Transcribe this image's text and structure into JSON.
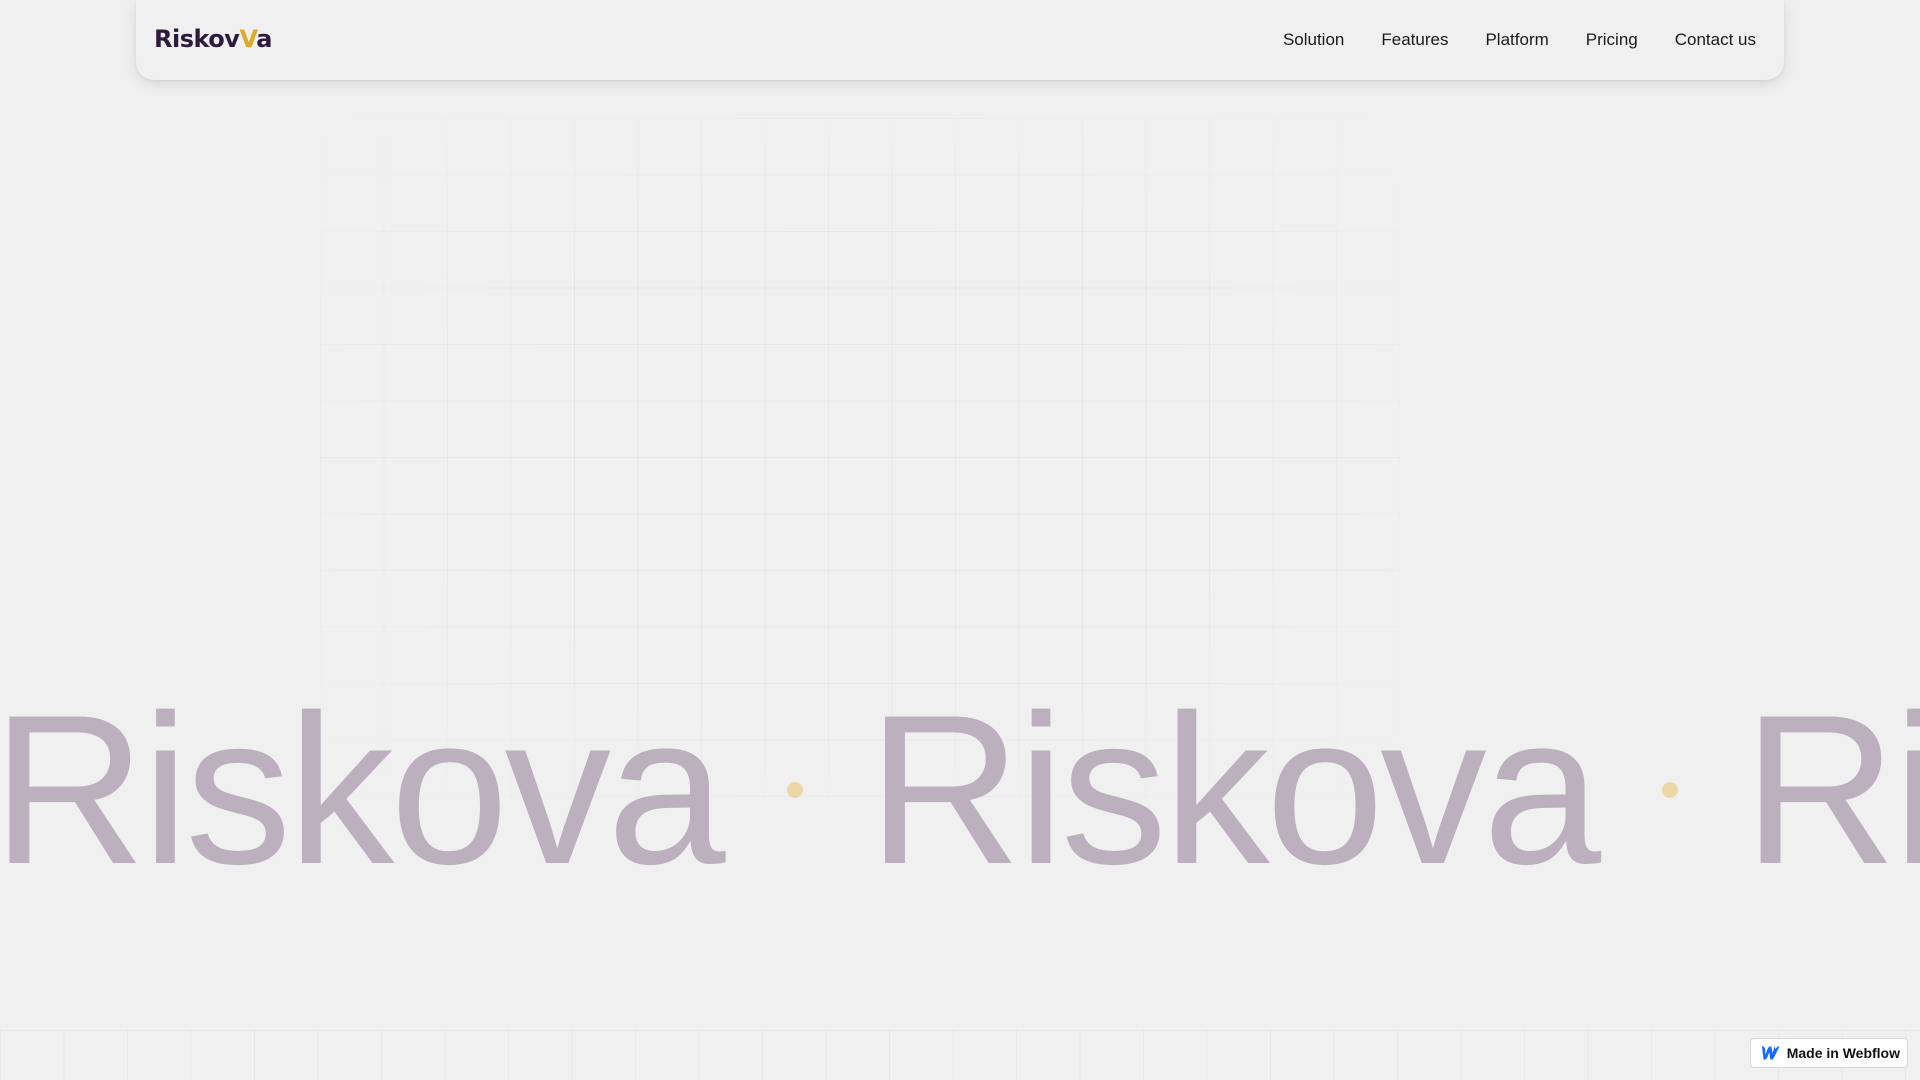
{
  "header": {
    "logo": {
      "text_start": "Riskov",
      "text_v": "V",
      "text_end": "a",
      "colors": {
        "primary": "#2d1a3d",
        "accent": "#e0a829"
      }
    },
    "nav": [
      {
        "label": "Solution"
      },
      {
        "label": "Features"
      },
      {
        "label": "Platform"
      },
      {
        "label": "Pricing"
      },
      {
        "label": "Contact us"
      }
    ]
  },
  "marquee": {
    "words": [
      "Riskova",
      "Riskova",
      "Riskova"
    ],
    "word_color": "#bcb0bf",
    "dot_color": "#ecd6a6"
  },
  "badge": {
    "label": "Made in Webflow",
    "icon": "webflow-icon",
    "icon_color": "#146ef5"
  },
  "colors": {
    "background": "#f0f0f0"
  }
}
